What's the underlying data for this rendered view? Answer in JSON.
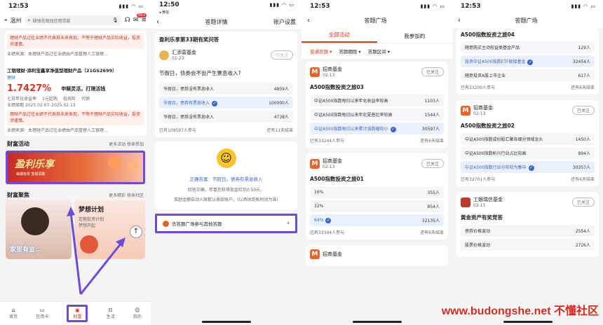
{
  "p1": {
    "time": "12:53",
    "city": "温州",
    "search_placeholder": "缺钱花就找信用贷款",
    "badge": "99+",
    "warn1": "理财产品过往业绩不代表其未来表现，不等于理财产品实际收益，投资须谨慎。",
    "warn1_sub": "业绩来源：本理财产品过往业绩由产品管理人工银理...",
    "product_name": "工银理财·添利宝鑫享净值型理财产品（21GS2699）",
    "product_tag": "理财",
    "rate": "1.7427%",
    "rate_slogan": "申赎灵活，打理活钱",
    "rate_label": "七日年化收益率",
    "min_buy": "1元起购",
    "risk": "低风险",
    "flex": "代销",
    "period": "业绩周期 2025.02.07–2025.02.13",
    "warn2": "理财产品过往业绩不代表其未来表现，不等于理财产品实际收益，投资须谨慎。",
    "warn2_sub": "业绩来源：本理财产品过往业绩由产品管理人工银理...",
    "wealth_activity": "财富活动",
    "more_activity": "更多活动 快来参加",
    "banner_text": "盈利乐享",
    "banner_sub": "每期有奖 答题领取",
    "wealth_gather": "财富聚焦",
    "more_gather": "更多精彩 快来社区",
    "plan_title": "梦想计划",
    "plan_sub1": "定期投资计划",
    "plan_sub2": "梦想开起",
    "plan_btn": "开启",
    "person_caption": "家里有金…",
    "nav": [
      "首页",
      "信用卡",
      "财富",
      "生活",
      "我的"
    ]
  },
  "p2": {
    "time": "12:50",
    "back_app": "◂ 微信",
    "title": "答题详情",
    "settings": "账户设置",
    "question_title": "盈利乐享第33期有奖问答",
    "org": "汇添富基金",
    "org_date": "01-23",
    "followed": "已关注",
    "question": "节假日，债券会不会产生票息收入?",
    "options": [
      {
        "label": "节假日，债券没有票息收入",
        "count": "4859人",
        "selected": false
      },
      {
        "label": "节假日，债券有票息收入",
        "count": "100000人",
        "selected": true
      },
      {
        "label": "节假日，债券没有票息收入",
        "count": "4738人",
        "selected": false
      }
    ],
    "participants": "已有109597人参与",
    "ended": "还有11天结束",
    "answer_prefix": "正确答案：",
    "answer": "节假日，债券有票息收入",
    "reward_line": "回答正确，恭喜您获得现金红包0.50元，",
    "reward_line2": "奖励金额自动入账默认收款账户。(以具体到账时间为准)",
    "goto": "去答题广场参与其他答题"
  },
  "p3": {
    "time": "12:53",
    "title": "答题广场",
    "tab_all": "全部活动",
    "tab_mine": "我参加的",
    "filters": [
      "普通答题",
      "答题期限",
      "答题区间"
    ],
    "cards": [
      {
        "org": "招商基金",
        "date": "02-13",
        "follow": "已关注",
        "title": "A500指数投资之旅03",
        "options": [
          {
            "label": "中证A500指数每日以来年化收益率较高",
            "count": "1103人",
            "selected": false
          },
          {
            "label": "中证A500指数每日以来年化夏普比率较高",
            "count": "1544人",
            "selected": false
          },
          {
            "label": "中证A500指数每日以来累计涨跌幅较小",
            "count": "30597人",
            "selected": true
          }
        ],
        "participants": "已有33244人参与",
        "ended": "还有6天结束"
      },
      {
        "org": "招商基金",
        "date": "02-13",
        "follow": "已关注",
        "title": "A500指数投资之旅01",
        "options": [
          {
            "label": "16%",
            "count": "355人",
            "selected": false
          },
          {
            "label": "32%",
            "count": "854人",
            "selected": false
          },
          {
            "label": "64%",
            "count": "32135人",
            "selected": true
          }
        ],
        "participants": "已有33344人参与",
        "ended": "还有6天结束"
      },
      {
        "org": "招商基金",
        "date": "",
        "follow": "",
        "title": ""
      }
    ]
  },
  "p4": {
    "time": "12:53",
    "title": "答题广场",
    "top_title": "A500指数投资之旅04",
    "top_options": [
      {
        "label": "随意购买主动权益类基金产品",
        "count": "129人",
        "selected": false
      },
      {
        "label": "投资中证A500指数ETF联接基金",
        "count": "32454人",
        "selected": true
      },
      {
        "label": "随意投资A股上市企业",
        "count": "617人",
        "selected": false
      }
    ],
    "top_participants": "已有33200人参与",
    "top_ended": "还有6天结束",
    "card2": {
      "org": "招商基金",
      "date": "02-13",
      "follow": "已关注",
      "title": "A500指数投资之旅02",
      "options": [
        {
          "label": "中证A500指数成份股汇聚各细分领域龙头",
          "count": "1450人",
          "selected": false
        },
        {
          "label": "中证A500指数析兴行业占比较高",
          "count": "894人",
          "selected": false
        },
        {
          "label": "中证A500指数行业分布较为集中",
          "count": "30357人",
          "selected": true
        }
      ],
      "participants": "已有32701人参与",
      "ended": "还有6天结束"
    },
    "card3": {
      "org": "工银瑞信基金",
      "date": "02-11",
      "follow": "已关注",
      "title": "黄金资产有奖竞答",
      "options": [
        {
          "label": "债券价格波动",
          "count": "2554人",
          "selected": false
        },
        {
          "label": "股票价格波动",
          "count": "2726人",
          "selected": false
        }
      ]
    }
  },
  "watermark": "www.budongshe.net 不懂社区",
  "colors": {
    "accent": "#6b4bd8",
    "red": "#d9381e",
    "blue": "#3a66c4"
  }
}
